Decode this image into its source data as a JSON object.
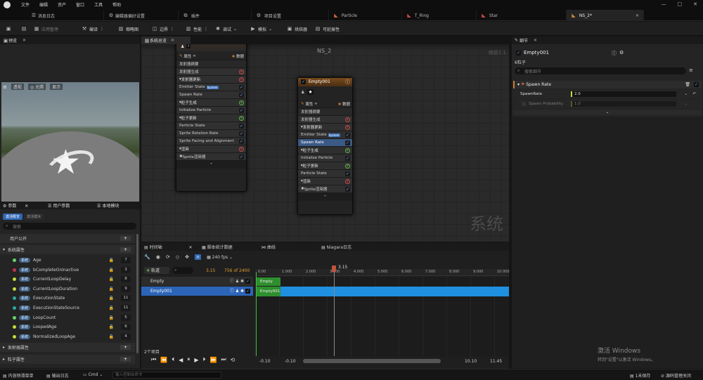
{
  "menu": {
    "items": [
      "文件",
      "编辑",
      "资产",
      "窗口",
      "工具",
      "帮助"
    ]
  },
  "window": {
    "controls": [
      "—",
      "□",
      "✕"
    ]
  },
  "tabs": [
    {
      "label": "消息日志"
    },
    {
      "label": "编辑器偏好设置"
    },
    {
      "label": "插件"
    },
    {
      "label": "项目设置"
    },
    {
      "label": "Particle"
    },
    {
      "label": "T_Ring"
    },
    {
      "label": "Star"
    },
    {
      "label": "NS_2*"
    }
  ],
  "toolbar": {
    "apply": "应用暂停",
    "compile": "编译",
    "thumbnail": "缩略图",
    "bounds": "边界",
    "performance": "性能",
    "debug": "调试",
    "simulate": "模拟",
    "baker": "烘焙器",
    "scalability": "可延展性"
  },
  "preview": {
    "title": "预览",
    "perspective": "透视",
    "lit": "光照",
    "show": "显示",
    "axis_z": "Z",
    "axis_x": "X"
  },
  "system_overview": {
    "title": "系统总览",
    "name": "NS_2",
    "zoom": "缩放1:1",
    "watermark": "系统"
  },
  "node_left": {
    "props": "属性",
    "data": "数据",
    "rows": [
      {
        "label": "发射器摘要",
        "kind": "sub"
      },
      {
        "label": "发射器生成",
        "kind": "item",
        "end": "plus"
      },
      {
        "label": "发射器更新",
        "kind": "sec",
        "end": "plus"
      },
      {
        "label": "Emitter State",
        "kind": "item",
        "tag": "System",
        "end": "chk"
      },
      {
        "label": "Spawn Rate",
        "kind": "item",
        "end": "chk"
      },
      {
        "label": "粒子生成",
        "kind": "sec",
        "end": "plusg"
      },
      {
        "label": "Initialize Particle",
        "kind": "item",
        "end": "chk"
      },
      {
        "label": "粒子更新",
        "kind": "sec",
        "end": "plusg"
      },
      {
        "label": "Particle State",
        "kind": "item",
        "end": "chk"
      },
      {
        "label": "Sprite Rotation Rate",
        "kind": "item",
        "end": "chk"
      },
      {
        "label": "Sprite Facing and Alignment",
        "kind": "item",
        "end": "chk"
      },
      {
        "label": "渲染",
        "kind": "sec",
        "end": "plus"
      },
      {
        "label": "Sprite渲染器",
        "kind": "item",
        "end": "chk"
      }
    ]
  },
  "node_right": {
    "title": "Empty001",
    "props": "属性",
    "data": "数据",
    "rows": [
      {
        "label": "发射器摘要",
        "kind": "sub"
      },
      {
        "label": "发射器生成",
        "kind": "item",
        "end": "plus"
      },
      {
        "label": "发射器更新",
        "kind": "sec",
        "end": "plus"
      },
      {
        "label": "Emitter State",
        "kind": "item",
        "tag": "System",
        "end": "chk"
      },
      {
        "label": "Spawn Rate",
        "kind": "sel",
        "end": "chk"
      },
      {
        "label": "粒子生成",
        "kind": "sec",
        "end": "plusg"
      },
      {
        "label": "Initialize Particle",
        "kind": "item",
        "end": "chk"
      },
      {
        "label": "粒子更新",
        "kind": "sec",
        "end": "plusg"
      },
      {
        "label": "Particle State",
        "kind": "item",
        "end": "chk"
      },
      {
        "label": "渲染",
        "kind": "sec",
        "end": "plus"
      },
      {
        "label": "Sprite渲染器",
        "kind": "item",
        "end": "chk"
      }
    ]
  },
  "params_panel": {
    "tabs": [
      "参数",
      "用户参数",
      "本地模块"
    ],
    "filters": [
      "激活概览",
      "激活模块"
    ],
    "search_placeholder": "搜索",
    "sections": {
      "user": "用户公开",
      "system": "系统属性",
      "emitter": "发射器属性",
      "particle": "粒子属性"
    },
    "badge": "系统",
    "items": [
      {
        "name": "Age",
        "color": "#6bd36b",
        "value": "7"
      },
      {
        "name": "bCompleteOnInactive",
        "color": "#c0344a",
        "value": "3"
      },
      {
        "name": "CurrentLoopDelay",
        "color": "#c8d93a",
        "value": "8"
      },
      {
        "name": "CurrentLoopDuration",
        "color": "#c8d93a",
        "value": "9"
      },
      {
        "name": "ExecutionState",
        "color": "#2fa7a0",
        "value": "11"
      },
      {
        "name": "ExecutionStateSource",
        "color": "#2fa7a0",
        "value": "11"
      },
      {
        "name": "LoopCount",
        "color": "#6bd36b",
        "value": "5"
      },
      {
        "name": "LoopedAge",
        "color": "#c8d93a",
        "value": "6"
      },
      {
        "name": "NormalizedLoopAge",
        "color": "#c8d93a",
        "value": "4"
      }
    ]
  },
  "timeline": {
    "tabs": [
      "时间轴",
      "脚本统计数据",
      "曲线",
      "Niagara日志"
    ],
    "add_track": "轨道",
    "current": "3.15",
    "frames": "756 of 2400",
    "fps": "240 fps",
    "playhead": "3.15",
    "ruler": [
      "0.00",
      "1.000",
      "2.000",
      "3.000",
      "4.000",
      "5.000",
      "6.000",
      "7.000",
      "8.000",
      "9.000",
      "10.000"
    ],
    "tracks": [
      {
        "name": "Empty",
        "bar": "Empty"
      },
      {
        "name": "Empty001",
        "bar": "Empty001"
      }
    ],
    "count": "2个项目",
    "range": [
      "-0.10",
      "-0.10",
      "10.10",
      "11.45"
    ]
  },
  "details": {
    "title": "细节",
    "name": "Empty001",
    "subtitle": "6粒子",
    "search_placeholder": "搜索细节",
    "section": "Spawn Rate",
    "rows": [
      {
        "label": "SpawnRate",
        "value": "2.0"
      },
      {
        "label": "Spawn Probability",
        "value": "1.0"
      }
    ]
  },
  "status": {
    "content_drawer": "内容侧滑菜单",
    "output_log": "输出日志",
    "cmd": "Cmd",
    "console_placeholder": "输入控制台命令",
    "saved": "1未保存",
    "source_control": "源码管理关闭"
  },
  "watermark": {
    "line1": "激活 Windows",
    "line2": "转到\"设置\"以激活 Windows。"
  }
}
